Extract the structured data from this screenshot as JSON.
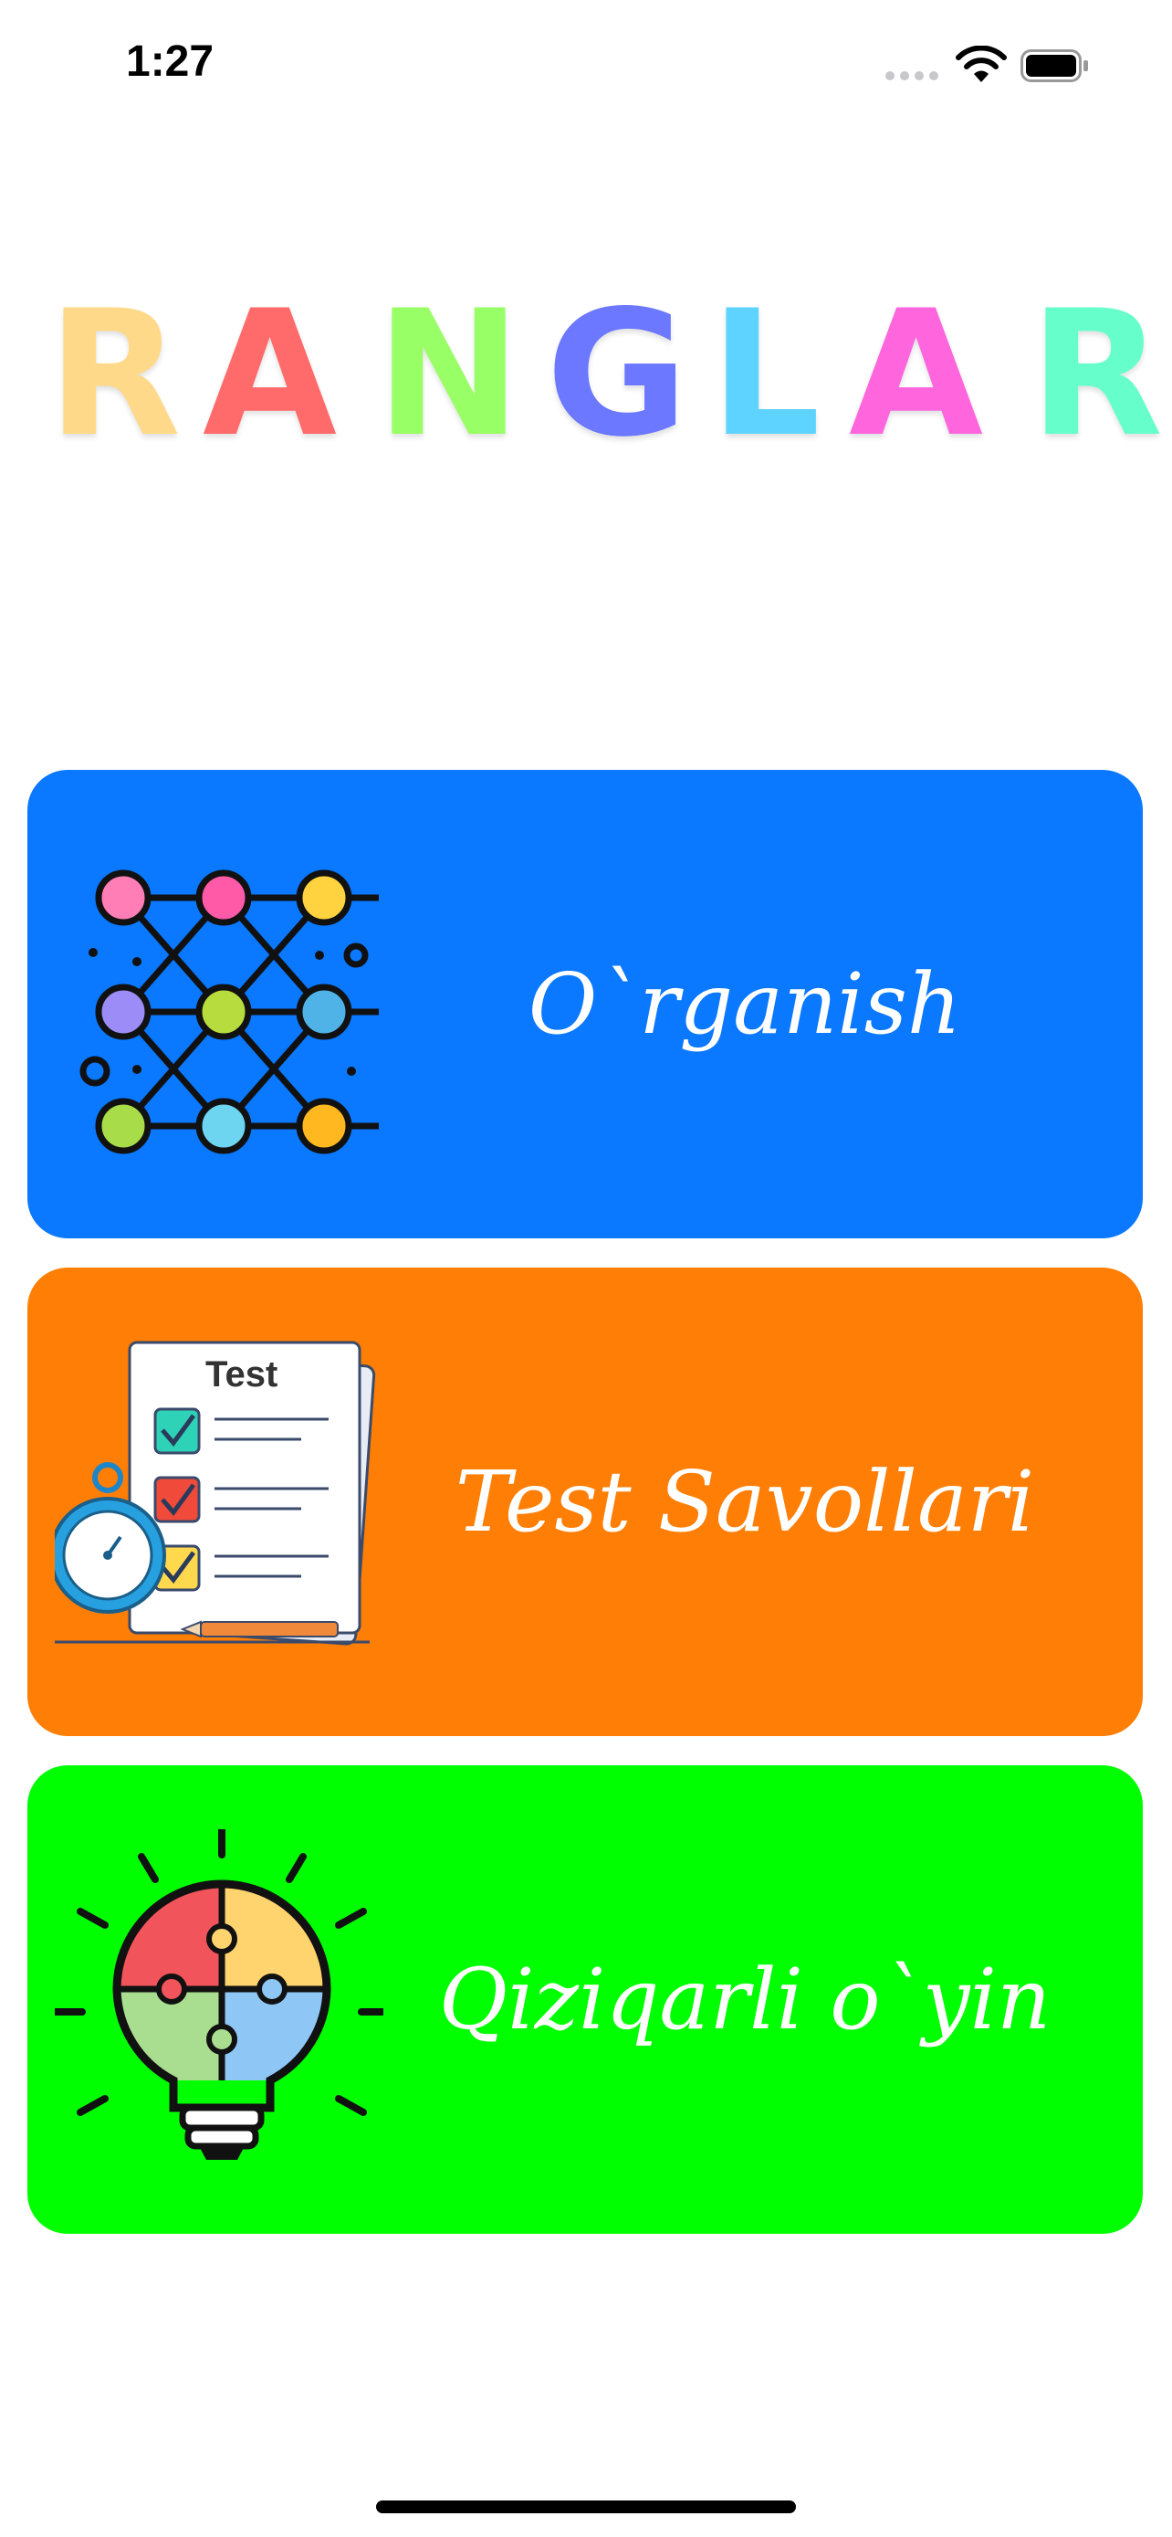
{
  "status_bar": {
    "time": "1:27",
    "icons": [
      "cellular-signal-icon",
      "wifi-icon",
      "battery-icon"
    ]
  },
  "title": {
    "letters": [
      "R",
      "A",
      "N",
      "G",
      "L",
      "A",
      "R"
    ],
    "colors": [
      "#ffd98a",
      "#ff6b6b",
      "#99ff66",
      "#6b78ff",
      "#5fd3ff",
      "#ff66dd",
      "#66ffcc"
    ]
  },
  "menu": {
    "learn": {
      "label": "O`rganish",
      "icon": "network-nodes-icon",
      "color": "#0a78ff"
    },
    "test": {
      "label": "Test Savollari",
      "icon": "test-sheet-icon",
      "icon_text": "Test",
      "color": "#ff7e05"
    },
    "game": {
      "label": "Qiziqarli o`yin",
      "icon": "puzzle-lightbulb-icon",
      "color": "#00ff00"
    }
  }
}
